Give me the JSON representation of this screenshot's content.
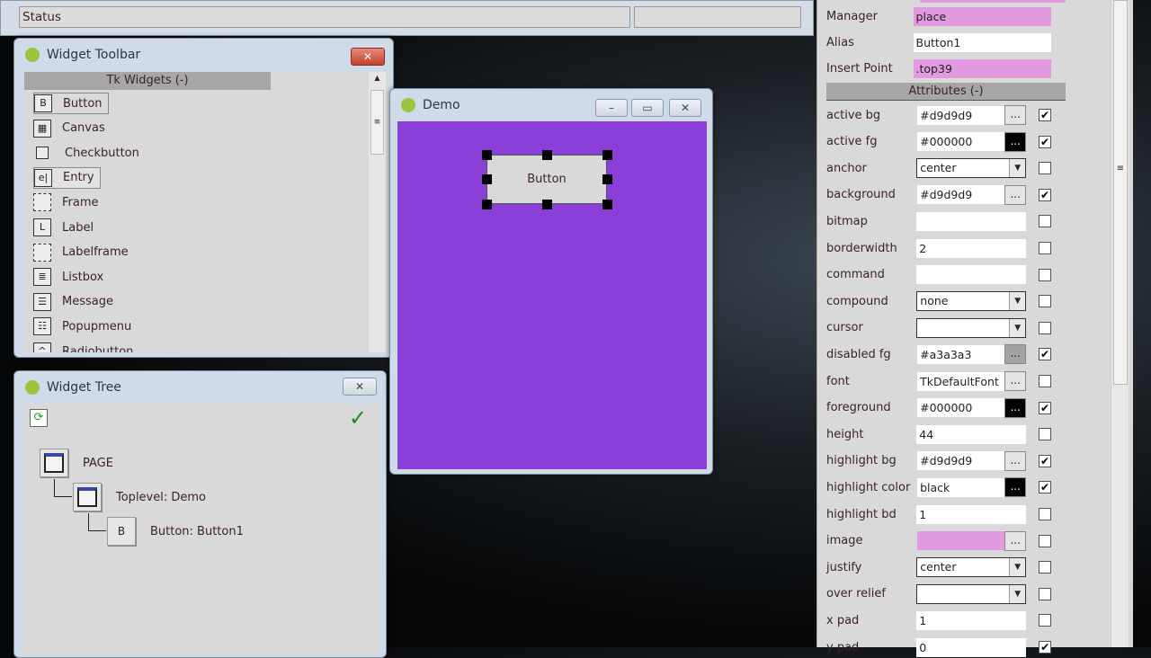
{
  "status_window": {
    "status_label": "Status"
  },
  "widget_toolbar": {
    "title": "Widget Toolbar",
    "close": "✕",
    "section": "Tk Widgets (-)",
    "items": [
      {
        "label": "Button",
        "icon": "B",
        "name": "button"
      },
      {
        "label": "Canvas",
        "icon": "▦",
        "name": "canvas"
      },
      {
        "label": "Checkbutton",
        "icon": "",
        "name": "checkbutton"
      },
      {
        "label": "Entry",
        "icon": "e|",
        "name": "entry"
      },
      {
        "label": "Frame",
        "icon": "",
        "name": "frame"
      },
      {
        "label": "Label",
        "icon": "L",
        "name": "label"
      },
      {
        "label": "Labelframe",
        "icon": "",
        "name": "labelframe"
      },
      {
        "label": "Listbox",
        "icon": "≣",
        "name": "listbox"
      },
      {
        "label": "Message",
        "icon": "☰",
        "name": "message"
      },
      {
        "label": "Popupmenu",
        "icon": "☷",
        "name": "popupmenu"
      },
      {
        "label": "Radiobutton",
        "icon": "^",
        "name": "radiobutton"
      }
    ]
  },
  "widget_tree": {
    "title": "Widget Tree",
    "close": "✕",
    "nodes": [
      "PAGE",
      "Toplevel: Demo",
      "Button: Button1"
    ]
  },
  "demo": {
    "title": "Demo",
    "button_label": "Button",
    "bg": "#8b3fd9"
  },
  "properties": {
    "manager_label": "Manager",
    "manager": "place",
    "alias_label": "Alias",
    "alias": "Button1",
    "insert_label": "Insert Point",
    "insert": ".top39",
    "section": "Attributes (-)",
    "rows": [
      {
        "label": "active bg",
        "value": "#d9d9d9",
        "ctl": "btn",
        "checked": true
      },
      {
        "label": "active fg",
        "value": "#000000",
        "ctl": "btn-black",
        "checked": true
      },
      {
        "label": "anchor",
        "value": "center",
        "ctl": "dd",
        "checked": false
      },
      {
        "label": "background",
        "value": "#d9d9d9",
        "ctl": "btn",
        "checked": true
      },
      {
        "label": "bitmap",
        "value": "",
        "ctl": "none",
        "checked": false
      },
      {
        "label": "borderwidth",
        "value": "2",
        "ctl": "none",
        "checked": false
      },
      {
        "label": "command",
        "value": "",
        "ctl": "none",
        "checked": false
      },
      {
        "label": "compound",
        "value": "none",
        "ctl": "dd",
        "checked": false
      },
      {
        "label": "cursor",
        "value": "",
        "ctl": "dd",
        "checked": false
      },
      {
        "label": "disabled fg",
        "value": "#a3a3a3",
        "ctl": "btn-gray",
        "checked": true
      },
      {
        "label": "font",
        "value": "TkDefaultFont",
        "ctl": "btn",
        "checked": false
      },
      {
        "label": "foreground",
        "value": "#000000",
        "ctl": "btn-black",
        "checked": true
      },
      {
        "label": "height",
        "value": "44",
        "ctl": "none",
        "checked": false
      },
      {
        "label": "highlight bg",
        "value": "#d9d9d9",
        "ctl": "btn",
        "checked": true
      },
      {
        "label": "highlight color",
        "value": "black",
        "ctl": "btn-black",
        "checked": true
      },
      {
        "label": "highlight bd",
        "value": "1",
        "ctl": "none",
        "checked": false
      },
      {
        "label": "image",
        "value": "",
        "ctl": "btn-pink",
        "checked": false
      },
      {
        "label": "justify",
        "value": "center",
        "ctl": "dd",
        "checked": false
      },
      {
        "label": "over relief",
        "value": "",
        "ctl": "dd",
        "checked": false
      },
      {
        "label": "x pad",
        "value": "1",
        "ctl": "none",
        "checked": false
      },
      {
        "label": "y pad",
        "value": "0",
        "ctl": "none",
        "checked": true
      }
    ]
  }
}
